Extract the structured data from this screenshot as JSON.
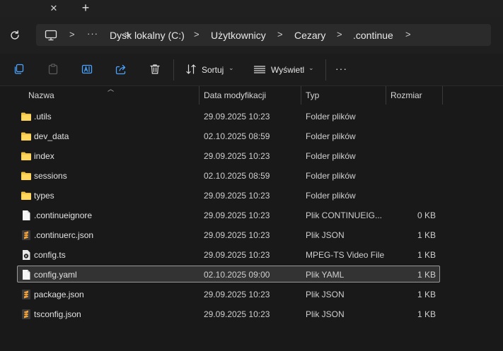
{
  "tabstrip": {
    "close_glyph": "✕",
    "new_tab_glyph": "+"
  },
  "breadcrumb": {
    "overflow": "···",
    "items": [
      "Dysk lokalny (C:)",
      "Użytkownicy",
      "Cezary",
      ".continue"
    ],
    "separator": ">"
  },
  "toolbar": {
    "sort_label": "Sortuj",
    "view_label": "Wyświetl",
    "more_glyph": "···"
  },
  "columns": {
    "name": "Nazwa",
    "date": "Data modyfikacji",
    "type": "Typ",
    "size": "Rozmiar"
  },
  "files": [
    {
      "name": ".utils",
      "date": "29.09.2025 10:23",
      "type": "Folder plików",
      "size": "",
      "icon": "folder-icon"
    },
    {
      "name": "dev_data",
      "date": "02.10.2025 08:59",
      "type": "Folder plików",
      "size": "",
      "icon": "folder-icon"
    },
    {
      "name": "index",
      "date": "29.09.2025 10:23",
      "type": "Folder plików",
      "size": "",
      "icon": "folder-icon"
    },
    {
      "name": "sessions",
      "date": "02.10.2025 08:59",
      "type": "Folder plików",
      "size": "",
      "icon": "folder-icon"
    },
    {
      "name": "types",
      "date": "29.09.2025 10:23",
      "type": "Folder plików",
      "size": "",
      "icon": "folder-icon"
    },
    {
      "name": ".continueignore",
      "date": "29.09.2025 10:23",
      "type": "Plik CONTINUEIG...",
      "size": "0 KB",
      "icon": "blank-file-icon"
    },
    {
      "name": ".continuerc.json",
      "date": "29.09.2025 10:23",
      "type": "Plik JSON",
      "size": "1 KB",
      "icon": "sublime-file-icon"
    },
    {
      "name": "config.ts",
      "date": "29.09.2025 10:23",
      "type": "MPEG-TS Video File",
      "size": "1 KB",
      "icon": "video-file-icon"
    },
    {
      "name": "config.yaml",
      "date": "02.10.2025 09:00",
      "type": "Plik YAML",
      "size": "1 KB",
      "icon": "blank-file-icon",
      "selected": true
    },
    {
      "name": "package.json",
      "date": "29.09.2025 10:23",
      "type": "Plik JSON",
      "size": "1 KB",
      "icon": "sublime-file-icon"
    },
    {
      "name": "tsconfig.json",
      "date": "29.09.2025 10:23",
      "type": "Plik JSON",
      "size": "1 KB",
      "icon": "sublime-file-icon"
    }
  ],
  "colors": {
    "background": "#191919",
    "folder": "#f4c542",
    "sublime": "#f2a33a",
    "selection_border": "#9a9a9a"
  }
}
